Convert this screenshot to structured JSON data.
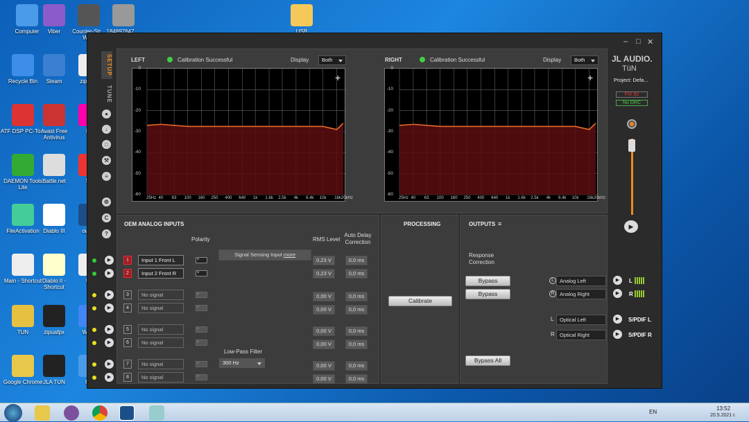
{
  "desktop": {
    "icons": [
      {
        "label": "Computer",
        "x": 6,
        "y": 6
      },
      {
        "label": "Viber",
        "x": 45,
        "y": 6
      },
      {
        "label": "Counter-Str... WaR",
        "x": 95,
        "y": 6
      },
      {
        "label": "184897647 ...",
        "x": 145,
        "y": 6
      },
      {
        "label": "USB",
        "x": 402,
        "y": 6
      },
      {
        "label": "Recycle Bin",
        "x": 0,
        "y": 78
      },
      {
        "label": "Steam",
        "x": 45,
        "y": 78
      },
      {
        "label": "zipi... .a",
        "x": 96,
        "y": 78
      },
      {
        "label": "ATF DSP PC-To...",
        "x": 0,
        "y": 150
      },
      {
        "label": "Avast Free Antivirus",
        "x": 45,
        "y": 150
      },
      {
        "label": "Do",
        "x": 96,
        "y": 150
      },
      {
        "label": "DAEMON Tools Lite",
        "x": 0,
        "y": 222
      },
      {
        "label": "Battle.net",
        "x": 45,
        "y": 222
      },
      {
        "label": "SC",
        "x": 96,
        "y": 222
      },
      {
        "label": "FileActivation",
        "x": 0,
        "y": 294
      },
      {
        "label": "Diablo III",
        "x": 45,
        "y": 294
      },
      {
        "label": "own...",
        "x": 96,
        "y": 294
      },
      {
        "label": "Main - Shortcut",
        "x": 0,
        "y": 366
      },
      {
        "label": "Diablo II - Shortcut",
        "x": 45,
        "y": 366
      },
      {
        "label": "Un",
        "x": 96,
        "y": 366
      },
      {
        "label": "TUN",
        "x": 0,
        "y": 440
      },
      {
        "label": "zipuafpx",
        "x": 45,
        "y": 440
      },
      {
        "label": "Werld",
        "x": 96,
        "y": 440
      },
      {
        "label": "Google Chrome",
        "x": 0,
        "y": 512
      },
      {
        "label": "JLA TUN",
        "x": 45,
        "y": 512
      },
      {
        "label": "HO",
        "x": 96,
        "y": 512
      }
    ]
  },
  "app": {
    "tabs": {
      "setup": "SETUP",
      "tune": "TUNE"
    },
    "brand": "JL AUDIO.",
    "brand2": "TüN",
    "project": "Project: Defa...",
    "fix": "FIX 82",
    "drc": "No DRC",
    "left": {
      "title": "LEFT",
      "status": "Calibration Successful",
      "display_label": "Display",
      "display_value": "Both"
    },
    "right": {
      "title": "RIGHT",
      "status": "Calibration Successful",
      "display_label": "Display",
      "display_value": "Both"
    },
    "chart_data": {
      "type": "line",
      "xlabel": "",
      "ylabel": "",
      "x_ticks": [
        "25Hz",
        "40",
        "63",
        "100",
        "160",
        "250",
        "400",
        "640",
        "1k",
        "1.6k",
        "2.5k",
        "4k",
        "6.4k",
        "10k",
        "16k20kHz"
      ],
      "y_ticks": [
        "0",
        "-10",
        "-20",
        "-30",
        "-40",
        "-50",
        "-60"
      ],
      "ylim": [
        -60,
        0
      ],
      "series": [
        {
          "x": [
            25,
            40,
            63,
            100,
            160,
            250,
            400,
            640,
            1000,
            1600,
            2500,
            4000,
            6400,
            10000,
            16000,
            20000
          ],
          "values": [
            -27,
            -26.5,
            -27,
            -27.5,
            -27.5,
            -27.5,
            -27.5,
            -27.5,
            -27.5,
            -27.5,
            -27.5,
            -27.5,
            -27.5,
            -27.5,
            -29,
            -26
          ]
        }
      ]
    },
    "oem": {
      "title": "OEM ANALOG INPUTS",
      "polarity": "Polarity",
      "rms": "RMS Level",
      "delay": "Auto Delay Correction",
      "signal_sensing": "Signal Sensing Input",
      "more": "more",
      "lpf_label": "Low-Pass Filter",
      "lpf_value": "300 Hz",
      "rows": [
        {
          "n": "1",
          "name": "Input 1 Front L",
          "rms": "0,23 V",
          "delay": "0,0 ms"
        },
        {
          "n": "2",
          "name": "Input 2 Front R",
          "rms": "0,23 V",
          "delay": "0,0 ms"
        },
        {
          "n": "3",
          "name": "No signal",
          "rms": "0,00 V",
          "delay": "0,0 ms"
        },
        {
          "n": "4",
          "name": "No signal",
          "rms": "0,00 V",
          "delay": "0,0 ms"
        },
        {
          "n": "5",
          "name": "No signal",
          "rms": "0,00 V",
          "delay": "0,0 ms"
        },
        {
          "n": "6",
          "name": "No signal",
          "rms": "0,00 V",
          "delay": "0,0 ms"
        },
        {
          "n": "7",
          "name": "No signal",
          "rms": "0,00 V",
          "delay": "0,0 ms"
        },
        {
          "n": "8",
          "name": "No signal",
          "rms": "0,00 V",
          "delay": "0,0 ms"
        }
      ]
    },
    "processing": {
      "title": "PROCESSING",
      "calibrate": "Calibrate"
    },
    "outputs": {
      "title": "OUTPUTS",
      "response": "Response Correction",
      "bypass": "Bypass",
      "bypass_all": "Bypass All",
      "analog_left": "Analog Left",
      "analog_right": "Analog Right",
      "optical_left": "Optical Left",
      "optical_right": "Optical Right",
      "L": "L",
      "R": "R",
      "spdif_l": "S/PDIF L",
      "spdif_r": "S/PDIF R"
    }
  },
  "taskbar": {
    "lang": "EN",
    "time": "13:52",
    "date": "20.5.2021 г."
  }
}
